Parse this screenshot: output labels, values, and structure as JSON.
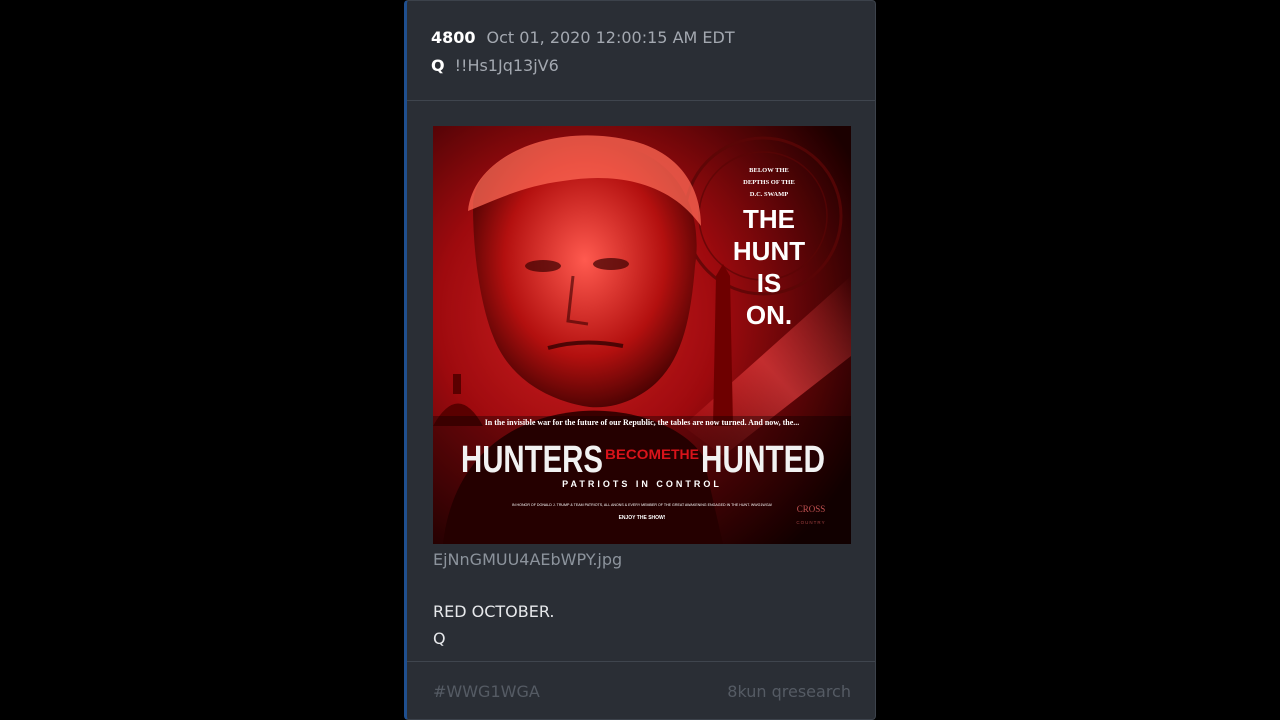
{
  "post": {
    "number": "4800",
    "date": "Oct 01, 2020 12:00:15 AM EDT",
    "author": "Q",
    "tripcode": "!!Hs1Jq13jV6"
  },
  "image": {
    "filename": "EjNnGMUU4AEbWPY.jpg",
    "tagline_top": [
      "BELOW THE",
      "DEPTHS OF THE",
      "D.C. SWAMP"
    ],
    "hunt_lines": [
      "THE",
      "HUNT",
      "IS",
      "ON."
    ],
    "intro_text": "In the invisible war for the future of our Republic, the tables are now turned. And now, the...",
    "title_left": "HUNTERS",
    "title_middle_top": "BECOME",
    "title_middle_bottom": "THE",
    "title_right": "HUNTED",
    "subtitle": "PATRIOTS IN CONTROL",
    "small_print": "IN HONOR OF DONALD J. TRUMP & TEAM PATRIOTS, ALL ANONS & EVERY MEMBER OF THE GREAT AWAKENING ENGAGED IN THE HUNT. WWG1WGA!",
    "enjoy": "ENJOY THE SHOW!",
    "logo_top": "CROSS",
    "logo_bottom": "COUNTRY",
    "colors": {
      "red": "#d8131a",
      "dark": "#1a0000"
    }
  },
  "message": {
    "line1": "RED OCTOBER.",
    "line2": "Q"
  },
  "footer": {
    "hashtag": "#WWG1WGA",
    "source": "8kun qresearch"
  }
}
